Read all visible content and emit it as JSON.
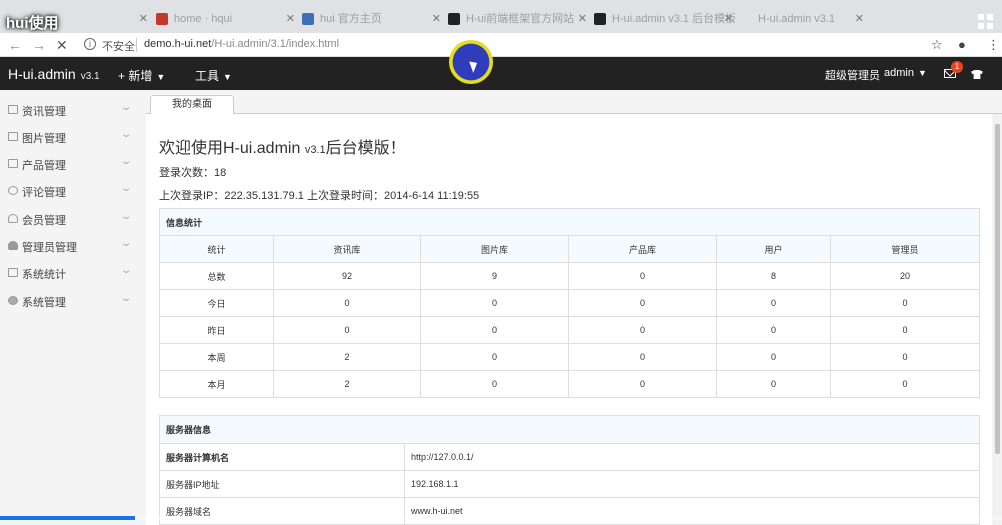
{
  "video": {
    "title": "hui使用",
    "progress": 0.135
  },
  "browser": {
    "tabs": [
      {
        "label": "",
        "x": 0
      },
      {
        "label": "home · hqui",
        "x": 0
      },
      {
        "label": "hui 官方主页",
        "x": 0
      },
      {
        "label": "H-ui前端框架官方网站",
        "x": 0
      },
      {
        "label": "H-ui.admin v3.1 后台模板",
        "x": 0
      },
      {
        "label": "H-ui.admin v3.1",
        "x": 0
      }
    ],
    "insecure_label": "不安全",
    "url_host": "demo.h-ui.net",
    "url_path": "/H-ui.admin/3.1/index.html"
  },
  "header": {
    "logo": "H-ui.admin",
    "version": "v3.1",
    "menu_new": "+ 新增",
    "menu_tools": "工具",
    "role": "超级管理员",
    "user": "admin",
    "notifications": "1"
  },
  "sidebar": {
    "items": [
      {
        "label": "资讯管理",
        "icon": "news-icon"
      },
      {
        "label": "图片管理",
        "icon": "image-icon"
      },
      {
        "label": "产品管理",
        "icon": "product-icon"
      },
      {
        "label": "评论管理",
        "icon": "comment-icon"
      },
      {
        "label": "会员管理",
        "icon": "member-icon"
      },
      {
        "label": "管理员管理",
        "icon": "admin-icon"
      },
      {
        "label": "系统统计",
        "icon": "stats-icon"
      },
      {
        "label": "系统管理",
        "icon": "settings-icon"
      }
    ]
  },
  "content": {
    "tab": "我的桌面",
    "welcome": "欢迎使用H-ui.admin",
    "welcome_version": "v3.1",
    "welcome_suffix": "后台模版！",
    "login_count": "登录次数：18",
    "last_login": "上次登录IP：222.35.131.79.1  上次登录时间：2014-6-14 11:19:55",
    "stats": {
      "caption": "信息统计",
      "headers": [
        "统计",
        "资讯库",
        "图片库",
        "产品库",
        "用户",
        "管理员"
      ],
      "rows": [
        [
          "总数",
          "92",
          "9",
          "0",
          "8",
          "20"
        ],
        [
          "今日",
          "0",
          "0",
          "0",
          "0",
          "0"
        ],
        [
          "昨日",
          "0",
          "0",
          "0",
          "0",
          "0"
        ],
        [
          "本周",
          "2",
          "0",
          "0",
          "0",
          "0"
        ],
        [
          "本月",
          "2",
          "0",
          "0",
          "0",
          "0"
        ]
      ]
    },
    "server": {
      "caption": "服务器信息",
      "rows": [
        [
          "服务器计算机名",
          "http://127.0.0.1/"
        ],
        [
          "服务器IP地址",
          "192.168.1.1"
        ],
        [
          "服务器域名",
          "www.h-ui.net"
        ]
      ]
    }
  }
}
